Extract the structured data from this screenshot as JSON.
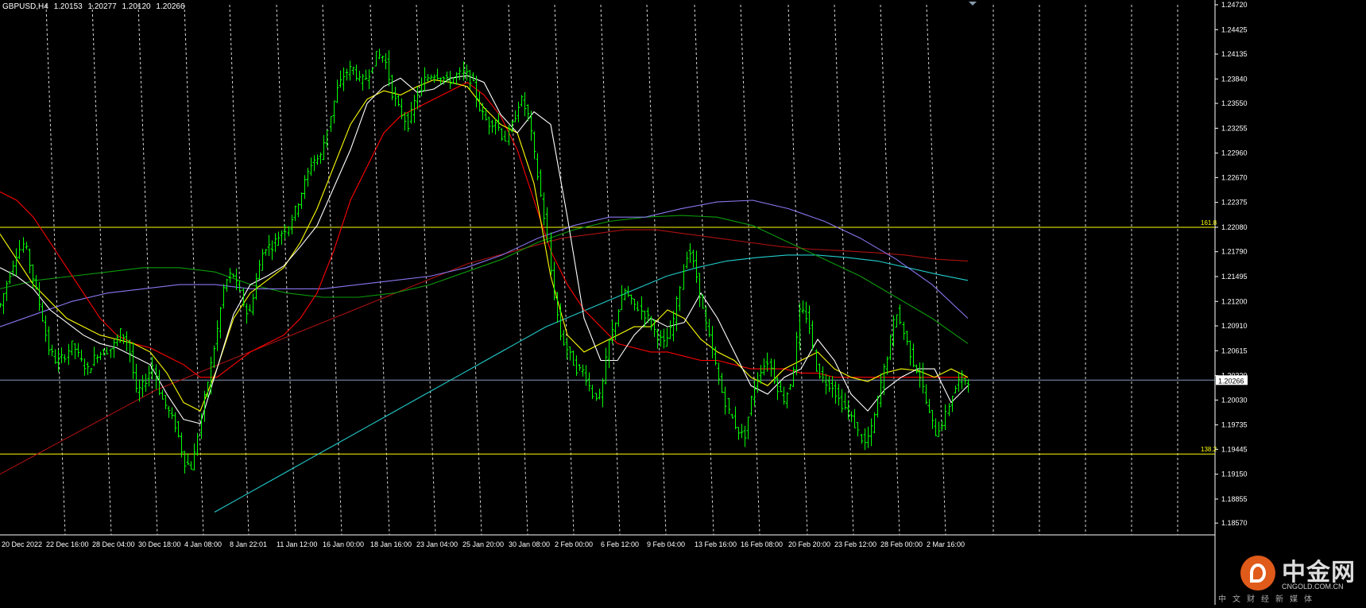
{
  "header": {
    "symbol": "GBPUSD,H4",
    "open": "1.20153",
    "high": "1.20277",
    "low": "1.20120",
    "close": "1.20266"
  },
  "colors": {
    "background": "#000000",
    "candle": "#00ff00",
    "grid": "#ffffff",
    "axis": "#ffffff",
    "fib": "#ffff00",
    "price_line": "#8899bb",
    "ma_white": "#ffffff",
    "ma_yellow": "#ffff00",
    "ma_red": "#ff0000",
    "ma_darkred": "#aa1111",
    "ma_green": "#0c9a0c",
    "ma_purple": "#8877ee",
    "ma_cyan": "#22cccc"
  },
  "watermark": {
    "title": "中金网",
    "domain": "CNGOLD.COM.CN",
    "subtitle": "中文财经新媒体"
  },
  "chart_data": {
    "type": "line",
    "symbol": "GBPUSD",
    "timeframe": "H4",
    "ylim": [
      1.1843,
      1.2472
    ],
    "grid": true,
    "y_ticks": [
      "1.24720",
      "1.24425",
      "1.24135",
      "1.23840",
      "1.23550",
      "1.23255",
      "1.22960",
      "1.22670",
      "1.22375",
      "1.22080",
      "1.21790",
      "1.21495",
      "1.21200",
      "1.20910",
      "1.20615",
      "1.20320",
      "1.20030",
      "1.19735",
      "1.19445",
      "1.19150",
      "1.18855",
      "1.18570"
    ],
    "x_labels": [
      "20 Dec 2022",
      "22 Dec 16:00",
      "28 Dec 04:00",
      "30 Dec 18:00",
      "4 Jan 08:00",
      "8 Jan 22:01",
      "11 Jan 12:00",
      "16 Jan 00:00",
      "18 Jan 16:00",
      "23 Jan 04:00",
      "25 Jan 20:00",
      "30 Jan 08:00",
      "2 Feb 00:00",
      "6 Feb 12:00",
      "9 Feb 04:00",
      "13 Feb 16:00",
      "16 Feb 08:00",
      "20 Feb 20:00",
      "23 Feb 12:00",
      "28 Feb 00:00",
      "2 Mar 16:00"
    ],
    "current_price": "1.20266",
    "current_price_value": 1.20266,
    "horizontal_levels": [
      {
        "label": "161.8",
        "value": 1.2208
      },
      {
        "label": "138.2",
        "value": 1.1939
      }
    ],
    "series": [
      {
        "name": "price",
        "values": [
          1.2116,
          1.2148,
          1.2176,
          1.219,
          1.215,
          1.2112,
          1.2065,
          1.2048,
          1.2055,
          1.207,
          1.205,
          1.2038,
          1.2058,
          1.206,
          1.2066,
          1.2084,
          1.207,
          1.2012,
          1.2022,
          1.2045,
          1.2008,
          1.199,
          1.197,
          1.193,
          1.1923,
          1.198,
          1.203,
          1.208,
          1.214,
          1.2155,
          1.2128,
          1.21,
          1.2148,
          1.2185,
          1.2186,
          1.22,
          1.221,
          1.2232,
          1.226,
          1.2288,
          1.229,
          1.233,
          1.237,
          1.239,
          1.2398,
          1.238,
          1.2388,
          1.2413,
          1.241,
          1.2366,
          1.2345,
          1.233,
          1.2363,
          1.2383,
          1.239,
          1.2388,
          1.238,
          1.2388,
          1.2392,
          1.238,
          1.2346,
          1.2331,
          1.2334,
          1.231,
          1.233,
          1.2362,
          1.234,
          1.228,
          1.222,
          1.214,
          1.208,
          1.206,
          1.204,
          1.2037,
          1.201,
          1.2006,
          1.207,
          1.21,
          1.2134,
          1.2118,
          1.211,
          1.21,
          1.2081,
          1.2069,
          1.209,
          1.214,
          1.2185,
          1.215,
          1.21,
          1.2063,
          1.202,
          1.199,
          1.197,
          1.1958,
          1.201,
          1.2038,
          1.205,
          1.202,
          1.2003,
          1.203,
          1.211,
          1.21,
          1.204,
          1.2025,
          1.202,
          1.2,
          1.199,
          1.197,
          1.195,
          1.1971,
          1.202,
          1.206,
          1.211,
          1.208,
          1.205,
          1.203,
          1.199,
          1.1963,
          1.198,
          1.201,
          1.203,
          1.2026
        ]
      },
      {
        "name": "ma_white",
        "values": [
          1.216,
          1.215,
          1.2135,
          1.211,
          1.2095,
          1.208,
          1.207,
          1.2065,
          1.2055,
          1.2045,
          1.201,
          1.198,
          1.1975,
          1.204,
          1.2105,
          1.214,
          1.215,
          1.2162,
          1.2185,
          1.221,
          1.2255,
          1.23,
          1.2355,
          1.2375,
          1.2385,
          1.2368,
          1.2372,
          1.2385,
          1.2388,
          1.238,
          1.2342,
          1.232,
          1.2345,
          1.233,
          1.222,
          1.21,
          1.205,
          1.205,
          1.208,
          1.21,
          1.209,
          1.2095,
          1.213,
          1.21,
          1.206,
          1.202,
          1.201,
          1.203,
          1.204,
          1.2075,
          1.205,
          1.201,
          1.199,
          1.2015,
          1.203,
          1.204,
          1.204,
          1.2,
          1.202
        ]
      },
      {
        "name": "ma_yellow",
        "values": [
          1.22,
          1.217,
          1.214,
          1.212,
          1.21,
          1.209,
          1.208,
          1.2075,
          1.207,
          1.206,
          1.2035,
          1.2,
          1.199,
          1.204,
          1.21,
          1.213,
          1.2145,
          1.216,
          1.219,
          1.223,
          1.228,
          1.233,
          1.236,
          1.237,
          1.2365,
          1.2375,
          1.2383,
          1.238,
          1.2375,
          1.235,
          1.233,
          1.232,
          1.226,
          1.215,
          1.208,
          1.206,
          1.207,
          1.208,
          1.209,
          1.209,
          1.211,
          1.21,
          1.2075,
          1.206,
          1.205,
          1.203,
          1.202,
          1.204,
          1.205,
          1.206,
          1.204,
          1.203,
          1.2025,
          1.2035,
          1.204,
          1.2038,
          1.203,
          1.204,
          1.203
        ]
      },
      {
        "name": "ma_red",
        "values": [
          1.225,
          1.224,
          1.222,
          1.219,
          1.216,
          1.213,
          1.21,
          1.208,
          1.207,
          1.2065,
          1.2055,
          1.2045,
          1.203,
          1.203,
          1.2045,
          1.206,
          1.207,
          1.208,
          1.21,
          1.213,
          1.218,
          1.224,
          1.228,
          1.232,
          1.234,
          1.235,
          1.236,
          1.237,
          1.238,
          1.2365,
          1.234,
          1.23,
          1.224,
          1.218,
          1.214,
          1.211,
          1.209,
          1.207,
          1.2065,
          1.206,
          1.206,
          1.2055,
          1.205,
          1.205,
          1.2045,
          1.204,
          1.204,
          1.204,
          1.2035,
          1.2035,
          1.203,
          1.203,
          1.203,
          1.203,
          1.203,
          1.203,
          1.203,
          1.203,
          1.203
        ]
      },
      {
        "name": "ma_darkred",
        "values": [
          1.1915,
          1.1935,
          1.1955,
          1.1975,
          1.1995,
          1.2015,
          1.203,
          1.2045,
          1.206,
          1.2075,
          1.209,
          1.2105,
          1.212,
          1.2135,
          1.215,
          1.2165,
          1.2175,
          1.2185,
          1.2195,
          1.22,
          1.2205,
          1.2205,
          1.22,
          1.2195,
          1.219,
          1.2185,
          1.2182,
          1.218,
          1.2178,
          1.2175,
          1.217,
          1.2168
        ]
      },
      {
        "name": "ma_green",
        "values": [
          1.2135,
          1.2145,
          1.215,
          1.2155,
          1.216,
          1.216,
          1.2155,
          1.214,
          1.213,
          1.2125,
          1.2125,
          1.213,
          1.214,
          1.2155,
          1.217,
          1.219,
          1.2205,
          1.2215,
          1.222,
          1.2222,
          1.222,
          1.221,
          1.219,
          1.217,
          1.215,
          1.2125,
          1.21,
          1.207
        ]
      },
      {
        "name": "ma_purple",
        "values": [
          1.209,
          1.2105,
          1.212,
          1.213,
          1.2135,
          1.214,
          1.214,
          1.2135,
          1.2135,
          1.2135,
          1.214,
          1.2145,
          1.215,
          1.216,
          1.2175,
          1.2195,
          1.221,
          1.222,
          1.222,
          1.223,
          1.2238,
          1.224,
          1.223,
          1.2215,
          1.2195,
          1.217,
          1.214,
          1.21
        ]
      },
      {
        "name": "ma_cyan",
        "values": [
          1.187,
          1.189,
          1.191,
          1.193,
          1.195,
          1.197,
          1.199,
          1.201,
          1.203,
          1.205,
          1.207,
          1.209,
          1.2105,
          1.212,
          1.2135,
          1.215,
          1.216,
          1.2168,
          1.2172,
          1.2175,
          1.2175,
          1.2172,
          1.2168,
          1.216,
          1.2152,
          1.2145
        ]
      }
    ]
  }
}
